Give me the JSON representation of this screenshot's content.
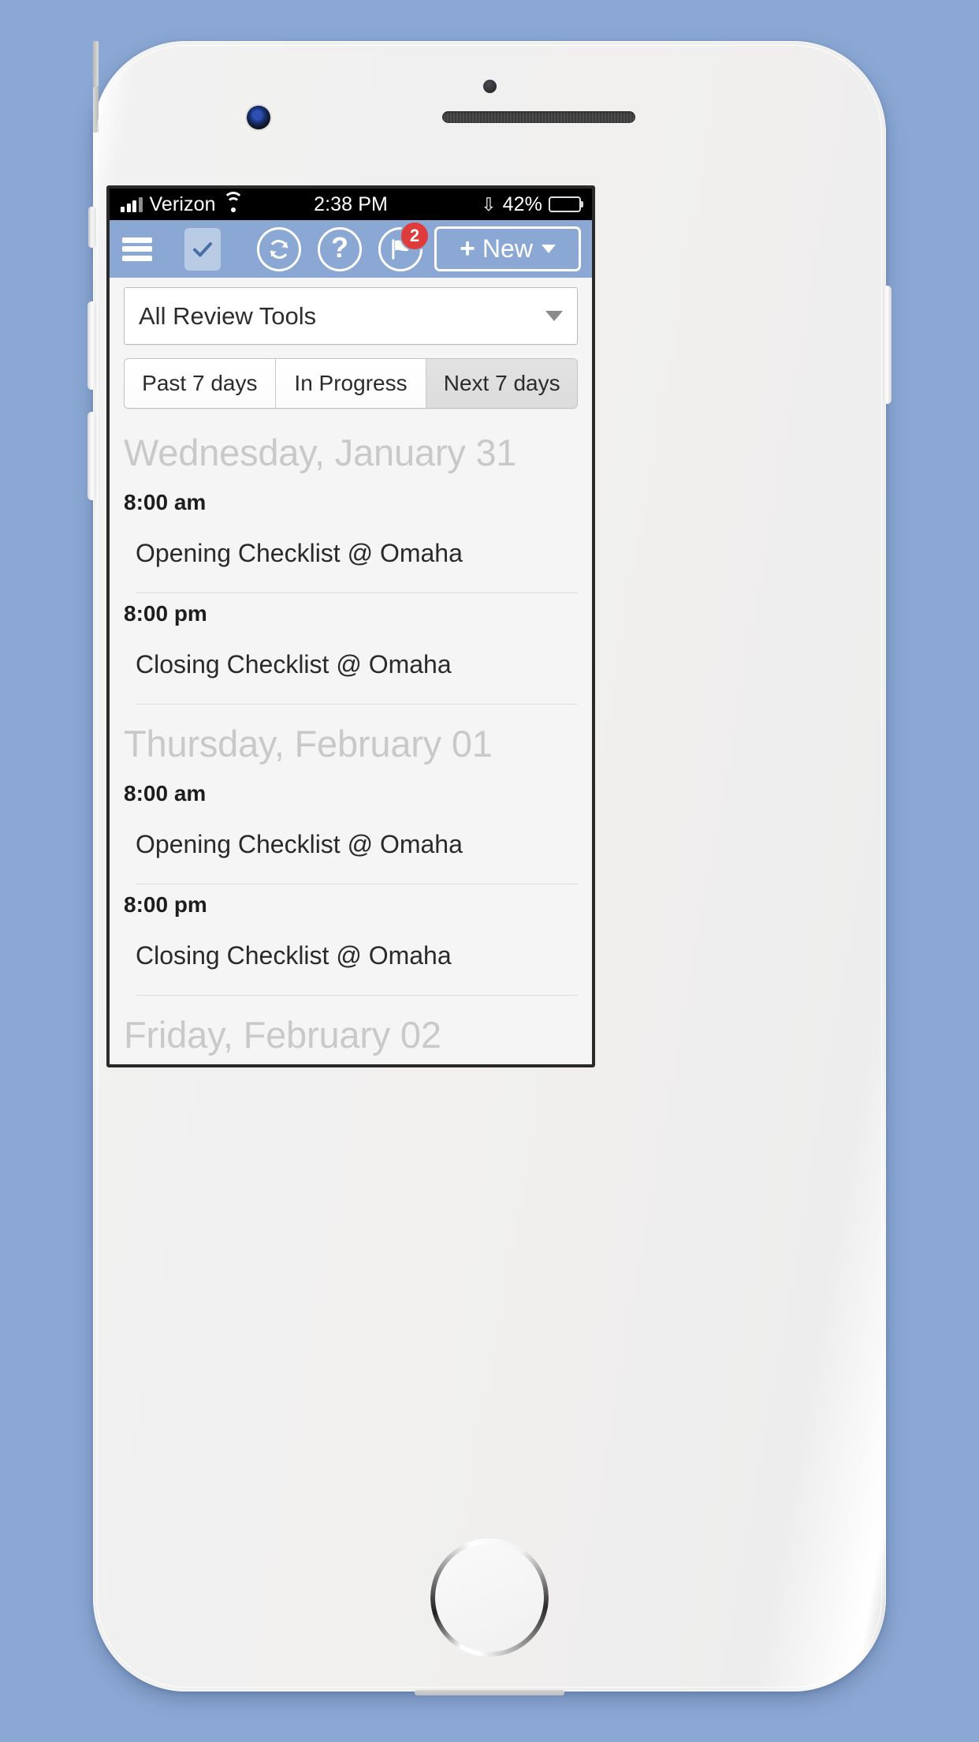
{
  "status_bar": {
    "carrier": "Verizon",
    "time": "2:38 PM",
    "battery_percent": "42%",
    "signal_icon": "signal-bars-icon",
    "wifi_icon": "wifi-icon",
    "bluetooth_glyph": "ʙ",
    "battery_icon": "battery-icon"
  },
  "app_bar": {
    "menu_icon": "hamburger-menu-icon",
    "checklist_tab_icon": "checkmark-icon",
    "refresh_icon": "refresh-icon",
    "help_glyph": "?",
    "flag_icon": "flag-icon",
    "notification_count": "2",
    "new_button": {
      "plus_glyph": "+",
      "label": "New"
    },
    "background_color": "#8ba8d4"
  },
  "filter": {
    "selected": "All Review Tools",
    "caret_icon": "chevron-down-icon"
  },
  "tabs": [
    {
      "label": "Past 7 days",
      "active": false
    },
    {
      "label": "In Progress",
      "active": false
    },
    {
      "label": "Next 7 days",
      "active": true
    }
  ],
  "schedule": [
    {
      "day": "Wednesday, January 31",
      "entries": [
        {
          "time": "8:00 am",
          "title": "Opening Checklist @ Omaha"
        },
        {
          "time": "8:00 pm",
          "title": "Closing Checklist @ Omaha"
        }
      ]
    },
    {
      "day": "Thursday, February 01",
      "entries": [
        {
          "time": "8:00 am",
          "title": "Opening Checklist @ Omaha"
        },
        {
          "time": "8:00 pm",
          "title": "Closing Checklist @ Omaha"
        }
      ]
    },
    {
      "day": "Friday, February 02",
      "entries": []
    }
  ],
  "colors": {
    "page_background": "#8ba8d4",
    "toolbar": "#8ba8d4",
    "badge": "#e03b3b",
    "day_header_text": "#c9c9c9",
    "screen_background": "#f5f5f5"
  }
}
